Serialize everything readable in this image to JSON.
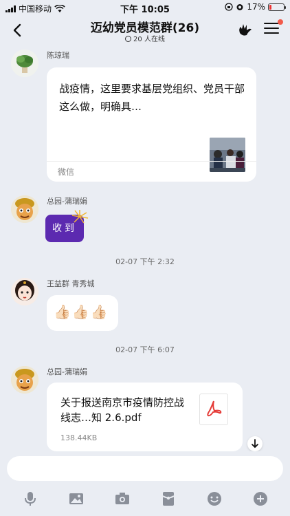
{
  "status": {
    "carrier": "中国移动",
    "time": "下午 10:05",
    "battery": "17%",
    "battery_level": 0.17
  },
  "header": {
    "title": "迈幼党员模范群(26)",
    "online": "20 人在线"
  },
  "messages": {
    "m1": {
      "sender": "陈琼瑞",
      "text": "战疫情，这里要求基层党组织、党员干部这么做，明确具…",
      "source": "微信"
    },
    "m2": {
      "sender": "总园-蒲瑞娟",
      "sticker_text": "收到"
    },
    "time1": "02-07 下午 2:32",
    "m3": {
      "sender": "王益群 青秀城",
      "text": "👍🏻👍🏻👍🏻"
    },
    "time2": "02-07 下午 6:07",
    "m4": {
      "sender": "总园-蒲瑞娟",
      "file_name": "关于报送南京市疫情防控战线志…知 2.6.pdf",
      "file_size": "138.44KB"
    }
  },
  "input": {
    "placeholder": ""
  },
  "colors": {
    "background": "#eaedf3",
    "accent_red": "#f25a4a",
    "sticker_purple": "#5c2ab0"
  }
}
